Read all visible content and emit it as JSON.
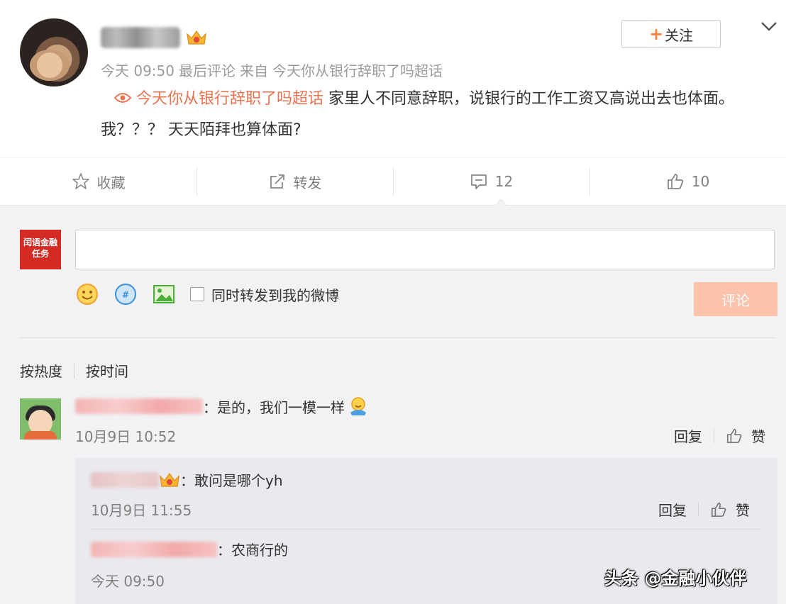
{
  "post": {
    "meta_time": "今天 09:50",
    "meta_last": "最后评论",
    "meta_from": "来自",
    "meta_source": "今天你从银行辞职了吗超话",
    "follow_label": "关注",
    "follow_plus": "+",
    "topic_link": "今天你从银行辞职了吗超话",
    "content_text": "家里人不同意辞职，说银行的工作工资又高说出去也体面。我？？？ 天天陌拜也算体面?"
  },
  "actions": {
    "favorite_label": "收藏",
    "repost_label": "转发",
    "comment_count": "12",
    "like_count": "10"
  },
  "composer": {
    "avatar_text": "闰语金融任务",
    "input_value": "",
    "repost_checkbox_label": "同时转发到我的微博",
    "submit_label": "评论"
  },
  "sort": {
    "hot_label": "按热度",
    "time_label": "按时间"
  },
  "comments": [
    {
      "text": "：是的，我们一模一样",
      "time": "10月9日 10:52",
      "reply_label": "回复",
      "like_label": "赞",
      "replies": [
        {
          "text": "：敢问是哪个yh",
          "time": "10月9日 11:55",
          "reply_label": "回复",
          "like_label": "赞"
        },
        {
          "text": "：农商行的",
          "time": "今天 09:50"
        }
      ]
    }
  ],
  "watermark": "头条 @金融小伙伴",
  "colors": {
    "accent": "#eb7350",
    "follow_plus": "#ff8140",
    "submit_bg": "#fcc2ac",
    "panel_bg": "#f2f2f5",
    "reply_bg": "#e9e9ee"
  },
  "icons": [
    "vip-crown-icon",
    "chevron-down-icon",
    "super-topic-icon",
    "star-icon",
    "share-icon",
    "comment-icon",
    "thumb-up-icon",
    "emoji-icon",
    "topic-icon",
    "image-icon"
  ]
}
